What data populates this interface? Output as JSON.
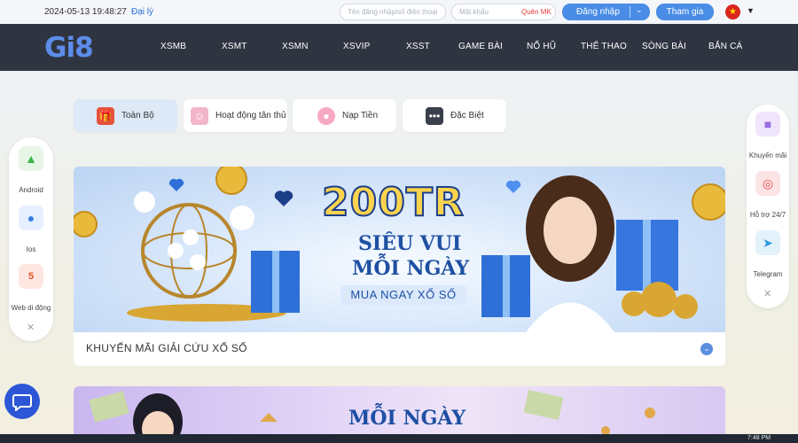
{
  "topbar": {
    "datetime": "2024-05-13 19:48:27",
    "agent_link": "Đại lý",
    "phone_placeholder": "Tên đăng nhập/số điện thoại",
    "password_placeholder": "Mật khẩu",
    "forgot_label": "Quên MK",
    "login_label": "Đăng nhập",
    "join_label": "Tham gia"
  },
  "nav": {
    "logo": "Gi8",
    "items": [
      "XSMB",
      "XSMT",
      "XSMN",
      "XSVIP",
      "XSST",
      "GAME BÀI",
      "NỔ HŨ",
      "THỂ THAO",
      "SÒNG BÀI",
      "BẮN CÁ"
    ]
  },
  "tabs": [
    "Toàn Bộ",
    "Hoạt động tân thủ",
    "Nạp Tiền",
    "Đặc Biệt"
  ],
  "promo": {
    "banner_title": "200TR",
    "banner_line1": "SIÊU VUI",
    "banner_line2": "MỖI NGÀY",
    "banner_line3": "MUA NGAY XỔ SỐ",
    "card_title": "KHUYẾN MÃI GIẢI CỨU XỔ SỐ",
    "banner2_title": "MỖI NGÀY"
  },
  "side_left": [
    "Android",
    "Ios",
    "Web di động"
  ],
  "side_right": [
    "Khuyến mãi",
    "Hỗ trợ 24/7",
    "Telegram"
  ],
  "taskbar": {
    "time": "7:48 PM"
  },
  "colors": {
    "accent": "#4a8de6",
    "nav_bg": "#2f3441",
    "banner_text": "#1e4fa3",
    "gold": "#fcd34d"
  }
}
